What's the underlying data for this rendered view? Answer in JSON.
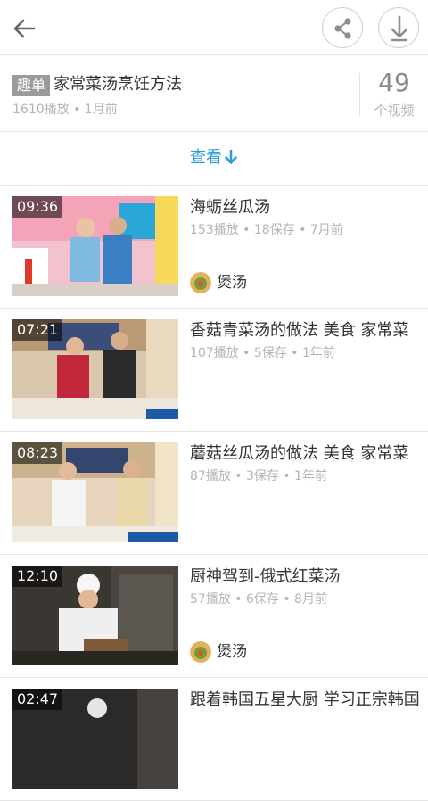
{
  "header": {
    "back_icon": "arrow-left-icon",
    "share_icon": "share-icon",
    "download_icon": "download-arrow-icon"
  },
  "playlist": {
    "badge": "趣单",
    "title": "家常菜汤烹饪方法",
    "meta": "1610播放 • 1月前",
    "count": "49",
    "count_label": "个视频"
  },
  "view_more": {
    "label": "查看",
    "icon": "arrow-down-icon",
    "color": "#2c9be0"
  },
  "videos": [
    {
      "duration": "09:36",
      "title": "海蛎丝瓜汤",
      "meta": "153播放 • 18保存 • 7月前",
      "uploader": "煲汤"
    },
    {
      "duration": "07:21",
      "title": "香菇青菜汤的做法 美食 家常菜",
      "meta": "107播放 • 5保存 • 1年前",
      "uploader": ""
    },
    {
      "duration": "08:23",
      "title": "蘑菇丝瓜汤的做法 美食 家常菜",
      "meta": "87播放 • 3保存 • 1年前",
      "uploader": ""
    },
    {
      "duration": "12:10",
      "title": "厨神驾到-俄式红菜汤",
      "meta": "57播放 • 6保存 • 8月前",
      "uploader": "煲汤"
    },
    {
      "duration": "02:47",
      "title": "跟着韩国五星大厨 学习正宗韩国",
      "meta": "",
      "uploader": ""
    }
  ]
}
